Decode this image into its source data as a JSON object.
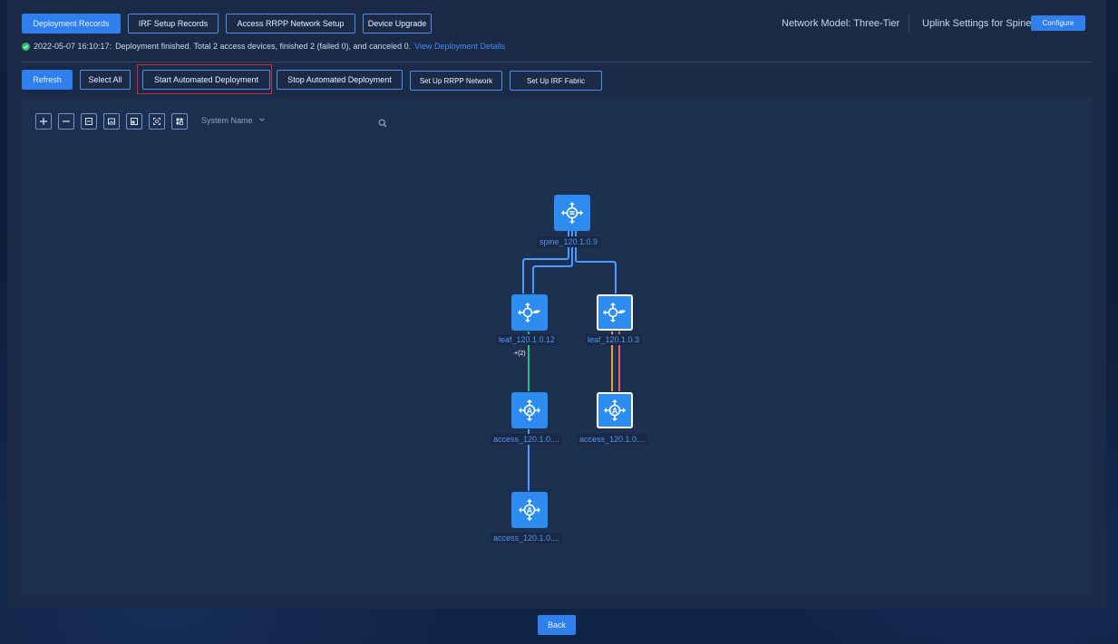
{
  "tabs": [
    {
      "label": "Deployment Records",
      "active": true
    },
    {
      "label": "IRF Setup Records",
      "active": false
    },
    {
      "label": "Access RRPP Network Setup",
      "active": false
    },
    {
      "label": "Device Upgrade",
      "active": false
    }
  ],
  "header": {
    "network_model": "Network Model: Three-Tier",
    "uplink_settings": "Uplink Settings for Spine:",
    "configure_label": "Configure"
  },
  "status": {
    "timestamp": "2022-05-07 16:10:17:",
    "message": "Deployment finished. Total 2 access devices, finished 2 (failed 0), and canceled 0.",
    "details_link": "View Deployment Details",
    "icon": "check-circle-icon",
    "color": "#2fbf71"
  },
  "actions": {
    "refresh": "Refresh",
    "select_all": "Select All",
    "start_deployment": "Start Automated Deployment",
    "stop_deployment": "Stop Automated Deployment",
    "setup_rrpp": "Set Up RRPP Network",
    "setup_irf": "Set Up IRF Fabric"
  },
  "toolbar": {
    "tools": [
      "zoom-in-icon",
      "zoom-out-icon",
      "save-icon",
      "image-icon",
      "layout-icon",
      "fit-icon",
      "legend-icon"
    ],
    "search_field": "System Name",
    "search_placeholder": ""
  },
  "topology": {
    "nodes": [
      {
        "id": "spine",
        "label": "spine_120.1.0.9",
        "type": "spine",
        "selected": false
      },
      {
        "id": "leaf1",
        "label": "leaf_120.1.0.12",
        "type": "leaf",
        "selected": false
      },
      {
        "id": "leaf2",
        "label": "leaf_120.1.0.3",
        "type": "leaf",
        "selected": true
      },
      {
        "id": "access1",
        "label": "access_120.1.0....",
        "type": "access",
        "selected": false
      },
      {
        "id": "access2",
        "label": "access_120.1.0....",
        "type": "access",
        "selected": true
      },
      {
        "id": "access3",
        "label": "access_120.1.0....",
        "type": "access",
        "selected": false
      }
    ],
    "aggregate_badge": "+(2)",
    "link_colors": {
      "default": "#4a9bff",
      "green": "#27c26b",
      "orange": "#f0a030",
      "red": "#e8596a"
    }
  },
  "footer": {
    "back_label": "Back"
  }
}
